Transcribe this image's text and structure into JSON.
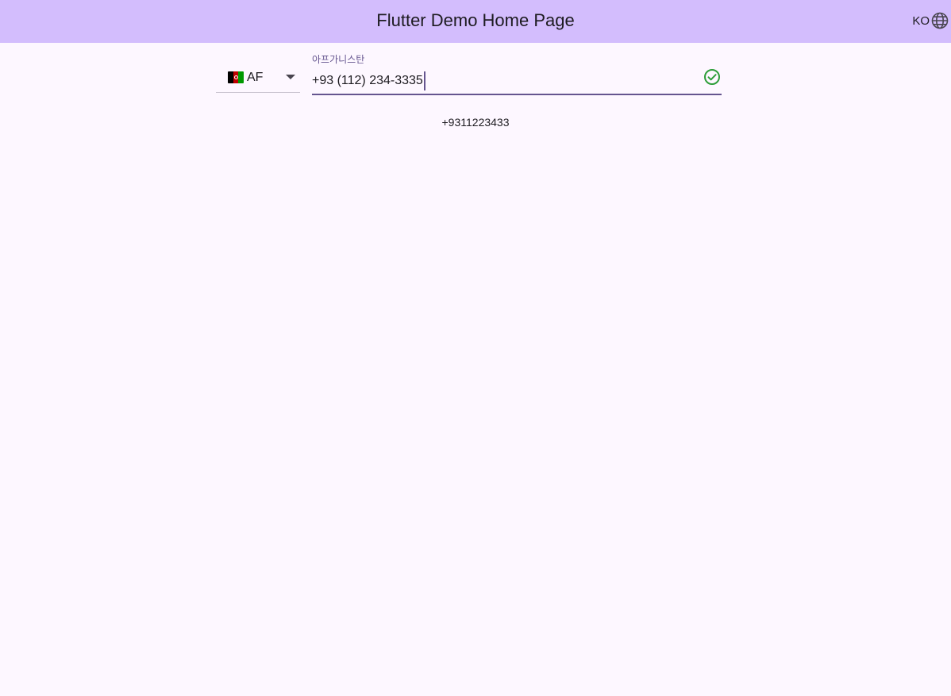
{
  "appbar": {
    "title": "Flutter Demo Home Page",
    "locale_label": "KO",
    "locale_icon": "globe-icon"
  },
  "country_selector": {
    "flag_icon": "afghanistan-flag-icon",
    "code": "AF",
    "dropdown_icon": "arrow-drop-down-icon"
  },
  "phone_input": {
    "label": "아프가니스탄",
    "value": "+93 (112) 234-3335",
    "valid_icon": "check-circle-icon"
  },
  "normalized_number": "+9311223433",
  "colors": {
    "appbar_background": "#d3bdfd",
    "page_background": "#fdf7ff",
    "accent": "#65558f",
    "valid": "#2e9e3a"
  }
}
